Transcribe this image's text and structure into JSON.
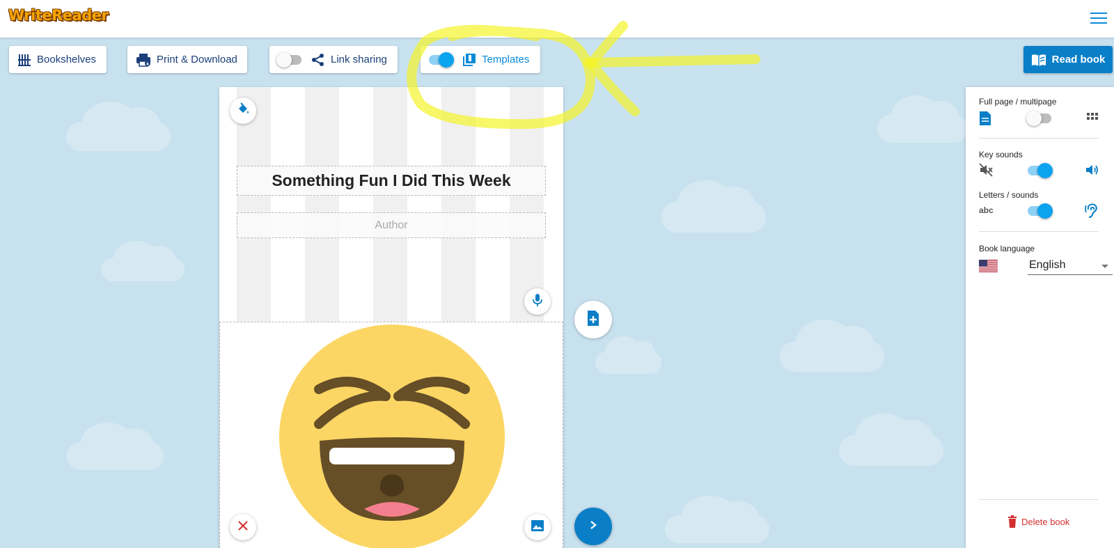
{
  "app": {
    "logo_text": "WriteReader"
  },
  "toolbar": {
    "bookshelves_label": "Bookshelves",
    "print_label": "Print & Download",
    "link_sharing_label": "Link sharing",
    "link_sharing_on": false,
    "templates_label": "Templates",
    "templates_on": true,
    "read_book_label": "Read book"
  },
  "book": {
    "title": "Something Fun I Did This Week",
    "author_placeholder": "Author"
  },
  "panel": {
    "page_mode_label": "Full page / multipage",
    "page_mode_multipage": false,
    "key_sounds_label": "Key sounds",
    "key_sounds_on": true,
    "letters_sounds_label": "Letters / sounds",
    "letters_sounds_on": true,
    "letters_icon_text": "abc",
    "book_language_label": "Book language",
    "book_language_value": "English",
    "delete_label": "Delete book"
  },
  "colors": {
    "accent": "#0a7fc8",
    "toggle_on": "#0aa3f0",
    "danger": "#d32f2f",
    "highlight": "#f4f42a"
  }
}
